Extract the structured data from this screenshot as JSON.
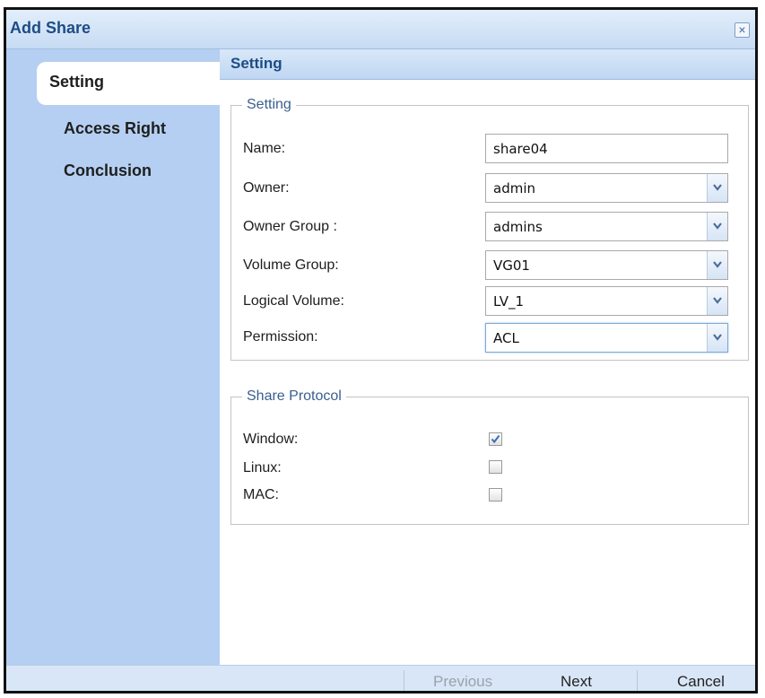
{
  "dialog": {
    "title": "Add Share",
    "close_glyph": "×"
  },
  "sidebar": {
    "items": [
      {
        "label": "Setting",
        "active": true
      },
      {
        "label": "Access Right",
        "active": false
      },
      {
        "label": "Conclusion",
        "active": false
      }
    ]
  },
  "content": {
    "section_title": "Setting",
    "setting_group": {
      "legend": "Setting",
      "fields": {
        "name": {
          "label": "Name:",
          "value": "share04"
        },
        "owner": {
          "label": "Owner:",
          "value": "admin"
        },
        "owner_group": {
          "label": "Owner Group :",
          "value": "admins"
        },
        "volume_group": {
          "label": "Volume Group:",
          "value": "VG01"
        },
        "logical_volume": {
          "label": "Logical Volume:",
          "value": "LV_1"
        },
        "permission": {
          "label": "Permission:",
          "value": "ACL"
        }
      }
    },
    "protocol_group": {
      "legend": "Share Protocol",
      "options": {
        "window": {
          "label": "Window:",
          "checked": true
        },
        "linux": {
          "label": "Linux:",
          "checked": false
        },
        "mac": {
          "label": "MAC:",
          "checked": false
        }
      }
    }
  },
  "footer": {
    "previous_label": "Previous",
    "next_label": "Next",
    "cancel_label": "Cancel"
  },
  "icons": {
    "close": "close-icon",
    "dropdown": "chevron-down-icon",
    "check": "checkmark-icon"
  },
  "colors": {
    "title_text": "#1d4c86",
    "sidebar_bg": "#b5cff2",
    "legend_text": "#3a5f8f",
    "check_mark": "#3d6fb5"
  }
}
